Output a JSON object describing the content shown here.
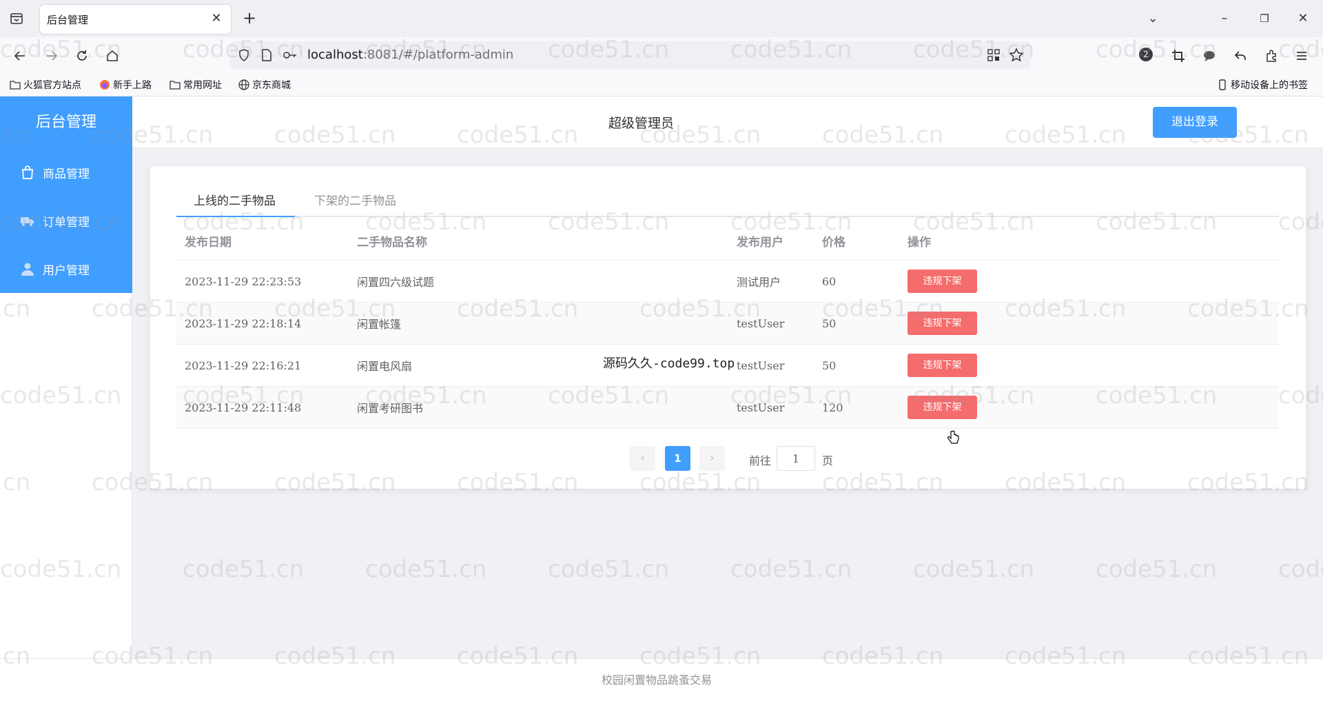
{
  "browser": {
    "tab_title": "后台管理",
    "url_host": "localhost",
    "url_rest": ":8081/#/platform-admin",
    "extension_badge": "2",
    "bookmarks": [
      {
        "label": "火狐官方站点",
        "icon": "folder-icon"
      },
      {
        "label": "新手上路",
        "icon": "firefox-icon"
      },
      {
        "label": "常用网址",
        "icon": "folder-icon"
      },
      {
        "label": "京东商城",
        "icon": "globe-icon"
      }
    ],
    "mobile_bookmarks": "移动设备上的书签"
  },
  "app": {
    "brand": "后台管理",
    "admin_name": "超级管理员",
    "logout_label": "退出登录",
    "menu": [
      {
        "label": "商品管理",
        "icon": "shopping-bag-icon"
      },
      {
        "label": "订单管理",
        "icon": "truck-icon"
      },
      {
        "label": "用户管理",
        "icon": "user-icon"
      }
    ],
    "tabs": [
      {
        "label": "上线的二手物品",
        "active": true
      },
      {
        "label": "下架的二手物品",
        "active": false
      }
    ],
    "table": {
      "headers": {
        "date": "发布日期",
        "name": "二手物品名称",
        "user": "发布用户",
        "price": "价格",
        "op": "操作"
      },
      "rows": [
        {
          "date": "2023-11-29 22:23:53",
          "name": "闲置四六级试题",
          "user": "测试用户",
          "price": "60",
          "action": "违规下架"
        },
        {
          "date": "2023-11-29 22:18:14",
          "name": "闲置帐篷",
          "user": "testUser",
          "price": "50",
          "action": "违规下架"
        },
        {
          "date": "2023-11-29 22:16:21",
          "name": "闲置电风扇",
          "user": "testUser",
          "price": "50",
          "action": "违规下架"
        },
        {
          "date": "2023-11-29 22:11:48",
          "name": "闲置考研图书",
          "user": "testUser",
          "price": "120",
          "action": "违规下架"
        }
      ]
    },
    "pagination": {
      "prev": "‹",
      "current": "1",
      "next": "›",
      "goto_prefix": "前往",
      "goto_value": "1",
      "goto_suffix": "页"
    },
    "overlay_text": "源码久久-code99.top",
    "footer": "校园闲置物品跳蚤交易",
    "watermark": "code51.cn"
  },
  "colors": {
    "primary": "#409eff",
    "danger": "#f56c6c"
  }
}
